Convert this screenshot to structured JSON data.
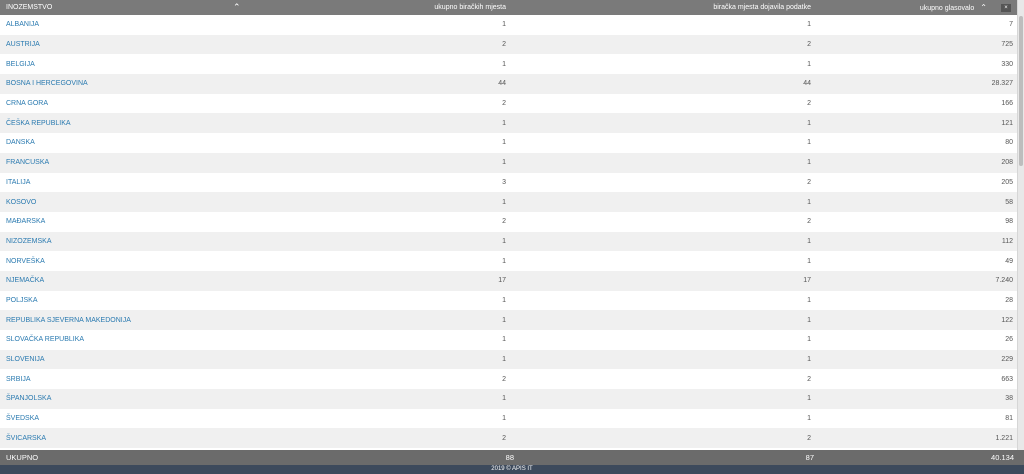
{
  "header": {
    "col_country": "INOZEMSTVO",
    "col_polling_total": "ukupno biračkih mjesta",
    "col_polling_reported": "biračka mjesta dojavila podatke",
    "col_voted_total": "ukupno glasovalo"
  },
  "rows": [
    {
      "country": "ALBANIJA",
      "total": "1",
      "reported": "1",
      "voted": "7"
    },
    {
      "country": "AUSTRIJA",
      "total": "2",
      "reported": "2",
      "voted": "725"
    },
    {
      "country": "BELGIJA",
      "total": "1",
      "reported": "1",
      "voted": "330"
    },
    {
      "country": "BOSNA I HERCEGOVINA",
      "total": "44",
      "reported": "44",
      "voted": "28.327"
    },
    {
      "country": "CRNA GORA",
      "total": "2",
      "reported": "2",
      "voted": "166"
    },
    {
      "country": "ČEŠKA REPUBLIKA",
      "total": "1",
      "reported": "1",
      "voted": "121"
    },
    {
      "country": "DANSKA",
      "total": "1",
      "reported": "1",
      "voted": "80"
    },
    {
      "country": "FRANCUSKA",
      "total": "1",
      "reported": "1",
      "voted": "208"
    },
    {
      "country": "ITALIJA",
      "total": "3",
      "reported": "2",
      "voted": "205"
    },
    {
      "country": "KOSOVO",
      "total": "1",
      "reported": "1",
      "voted": "58"
    },
    {
      "country": "MAĐARSKA",
      "total": "2",
      "reported": "2",
      "voted": "98"
    },
    {
      "country": "NIZOZEMSKA",
      "total": "1",
      "reported": "1",
      "voted": "112"
    },
    {
      "country": "NORVEŠKA",
      "total": "1",
      "reported": "1",
      "voted": "49"
    },
    {
      "country": "NJEMAČKA",
      "total": "17",
      "reported": "17",
      "voted": "7.240"
    },
    {
      "country": "POLJSKA",
      "total": "1",
      "reported": "1",
      "voted": "28"
    },
    {
      "country": "REPUBLIKA SJEVERNA MAKEDONIJA",
      "total": "1",
      "reported": "1",
      "voted": "122"
    },
    {
      "country": "SLOVAČKA REPUBLIKA",
      "total": "1",
      "reported": "1",
      "voted": "26"
    },
    {
      "country": "SLOVENIJA",
      "total": "1",
      "reported": "1",
      "voted": "229"
    },
    {
      "country": "SRBIJA",
      "total": "2",
      "reported": "2",
      "voted": "663"
    },
    {
      "country": "ŠPANJOLSKA",
      "total": "1",
      "reported": "1",
      "voted": "38"
    },
    {
      "country": "ŠVEDSKA",
      "total": "1",
      "reported": "1",
      "voted": "81"
    },
    {
      "country": "ŠVICARSKA",
      "total": "2",
      "reported": "2",
      "voted": "1.221"
    }
  ],
  "footer": {
    "label": "UKUPNO",
    "total": "88",
    "reported": "87",
    "voted": "40.134"
  },
  "copyright": "2019 © APIS IT",
  "icons": {
    "sort_up": "chevron-up-icon",
    "corner": "close-icon"
  }
}
